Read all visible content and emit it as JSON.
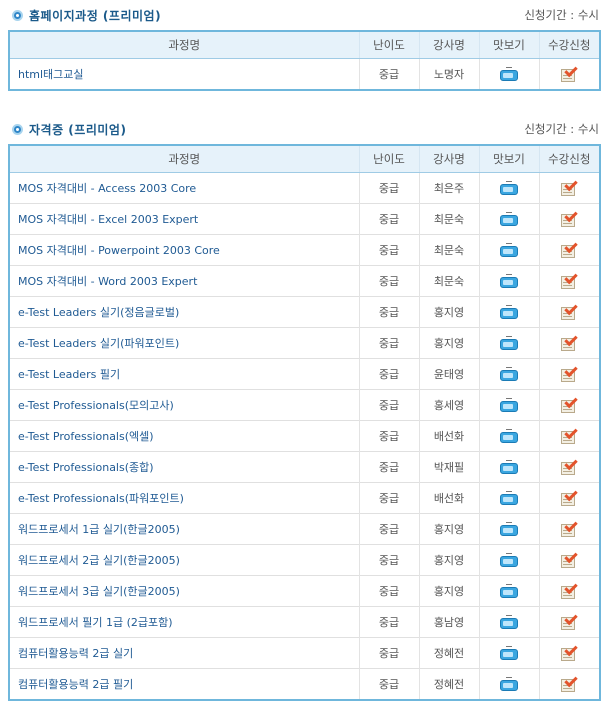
{
  "headers": [
    "과정명",
    "난이도",
    "강사명",
    "맛보기",
    "수강신청"
  ],
  "sections": [
    {
      "title": "홈페이지과정 (프리미엄)",
      "period": "신청기간 : 수시",
      "rows": [
        {
          "course": "html태그교실",
          "level": "중급",
          "teacher": "노명자"
        }
      ]
    },
    {
      "title": "자격증 (프리미엄)",
      "period": "신청기간 : 수시",
      "rows": [
        {
          "course": "MOS 자격대비 - Access 2003 Core",
          "level": "중급",
          "teacher": "최은주"
        },
        {
          "course": "MOS 자격대비 - Excel 2003 Expert",
          "level": "중급",
          "teacher": "최문숙"
        },
        {
          "course": "MOS 자격대비 - Powerpoint 2003 Core",
          "level": "중급",
          "teacher": "최문숙"
        },
        {
          "course": "MOS 자격대비 - Word 2003 Expert",
          "level": "중급",
          "teacher": "최문숙"
        },
        {
          "course": "e-Test Leaders 실기(정음글로벌)",
          "level": "중급",
          "teacher": "홍지영"
        },
        {
          "course": "e-Test Leaders 실기(파워포인트)",
          "level": "중급",
          "teacher": "홍지영"
        },
        {
          "course": "e-Test Leaders 필기",
          "level": "중급",
          "teacher": "윤태영"
        },
        {
          "course": "e-Test Professionals(모의고사)",
          "level": "중급",
          "teacher": "홍세영"
        },
        {
          "course": "e-Test Professionals(엑셀)",
          "level": "중급",
          "teacher": "배선화"
        },
        {
          "course": "e-Test Professionals(종합)",
          "level": "중급",
          "teacher": "박재필"
        },
        {
          "course": "e-Test Professionals(파워포인트)",
          "level": "중급",
          "teacher": "배선화"
        },
        {
          "course": "워드프로세서 1급 실기(한글2005)",
          "level": "중급",
          "teacher": "홍지영"
        },
        {
          "course": "워드프로세서 2급 실기(한글2005)",
          "level": "중급",
          "teacher": "홍지영"
        },
        {
          "course": "워드프로세서 3급 실기(한글2005)",
          "level": "중급",
          "teacher": "홍지영"
        },
        {
          "course": "워드프로세서 필기 1급 (2급포함)",
          "level": "중급",
          "teacher": "홍남영"
        },
        {
          "course": "컴퓨터활용능력 2급 실기",
          "level": "중급",
          "teacher": "정혜전"
        },
        {
          "course": "컴퓨터활용능력 2급 필기",
          "level": "중급",
          "teacher": "정혜전"
        }
      ]
    }
  ],
  "icons": {
    "preview": "tv-icon",
    "register": "register-check-icon"
  },
  "colors": {
    "border": "#6fb7dc",
    "header_bg": "#e6f2fa",
    "link": "#1f5a93",
    "title": "#1b5a8a"
  }
}
